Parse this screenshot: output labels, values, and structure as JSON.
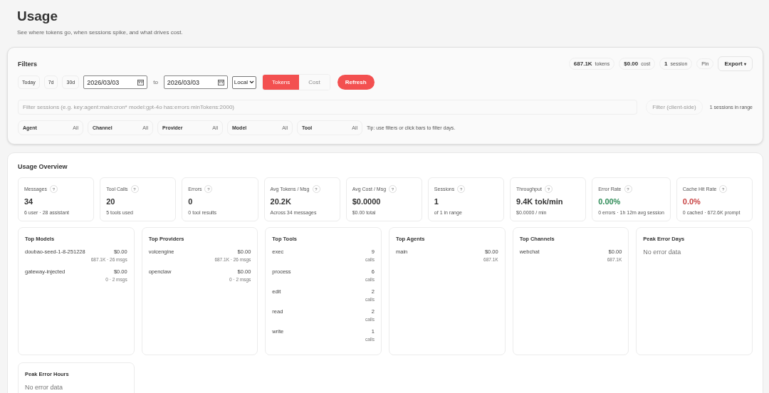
{
  "header": {
    "title": "Usage",
    "subtitle": "See where tokens go, when sessions spike, and what drives cost."
  },
  "filters": {
    "title": "Filters",
    "summary": [
      {
        "value": "687.1K",
        "unit": "tokens"
      },
      {
        "value": "$0.00",
        "unit": "cost"
      },
      {
        "value": "1",
        "unit": "session"
      }
    ],
    "actions": [
      {
        "label": "Pin",
        "kind": "pill"
      },
      {
        "label": "Export",
        "kind": "menu",
        "caret": "▾"
      }
    ],
    "presets": [
      "Today",
      "7d",
      "30d"
    ],
    "date_from": "2026/03/03",
    "separator": "to",
    "date_to": "2026/03/03",
    "timezone": "Local",
    "modes": [
      {
        "label": "Tokens",
        "selected": true
      },
      {
        "label": "Cost",
        "selected": false
      }
    ],
    "refresh": "Refresh",
    "query": {
      "placeholder": "Filter sessions (e.g. key:agent:main:cron* model:gpt-4o has:errors minTokens:2000)"
    },
    "apply": "Filter (client-side)",
    "range_note": "1 sessions in range",
    "dropdowns": [
      {
        "label": "Agent",
        "value": "All"
      },
      {
        "label": "Channel",
        "value": "All"
      },
      {
        "label": "Provider",
        "value": "All"
      },
      {
        "label": "Model",
        "value": "All"
      },
      {
        "label": "Tool",
        "value": "All"
      }
    ],
    "tip": "Tip: use filters or click bars to filter days."
  },
  "overview": {
    "title": "Usage Overview",
    "help": "?",
    "metrics": [
      {
        "label": "Messages",
        "value": "34",
        "note": "6 user · 28 assistant",
        "kind": "normal"
      },
      {
        "label": "Tool Calls",
        "value": "20",
        "note": "5 tools used",
        "kind": "normal"
      },
      {
        "label": "Errors",
        "value": "0",
        "note": "0 tool results",
        "kind": "normal"
      },
      {
        "label": "Avg Tokens / Msg",
        "value": "20.2K",
        "note": "Across 34 messages",
        "kind": "normal"
      },
      {
        "label": "Avg Cost / Msg",
        "value": "$0.0000",
        "note": "$0.00 total",
        "kind": "normal"
      },
      {
        "label": "Sessions",
        "value": "1",
        "note": "of 1 in range",
        "kind": "normal"
      },
      {
        "label": "Throughput",
        "value": "9.4K tok/min",
        "note": "$0.0000 / min",
        "kind": "normal"
      },
      {
        "label": "Error Rate",
        "value": "0.00%",
        "note": "0 errors · 1h 12m avg session",
        "kind": "good"
      },
      {
        "label": "Cache Hit Rate",
        "value": "0.0%",
        "note": "0 cached · 672.6K prompt",
        "kind": "bad"
      }
    ],
    "panels": [
      {
        "title": "Top Models",
        "kind": "list",
        "items": [
          {
            "name": "doubao-seed-1-8-251228",
            "value": "$0.00",
            "sub": "687.1K · 26 msgs"
          },
          {
            "name": "gateway-injected",
            "value": "$0.00",
            "sub": "0 · 2 msgs"
          }
        ]
      },
      {
        "title": "Top Providers",
        "kind": "list",
        "items": [
          {
            "name": "volcengine",
            "value": "$0.00",
            "sub": "687.1K · 26 msgs"
          },
          {
            "name": "openclaw",
            "value": "$0.00",
            "sub": "0 · 2 msgs"
          }
        ]
      },
      {
        "title": "Top Tools",
        "kind": "list",
        "items": [
          {
            "name": "exec",
            "value": "9",
            "sub": "calls"
          },
          {
            "name": "process",
            "value": "6",
            "sub": "calls"
          },
          {
            "name": "edit",
            "value": "2",
            "sub": "calls"
          },
          {
            "name": "read",
            "value": "2",
            "sub": "calls"
          },
          {
            "name": "write",
            "value": "1",
            "sub": "calls"
          }
        ]
      },
      {
        "title": "Top Agents",
        "kind": "list",
        "items": [
          {
            "name": "main",
            "value": "$0.00",
            "sub": "687.1K"
          }
        ]
      },
      {
        "title": "Top Channels",
        "kind": "list",
        "items": [
          {
            "name": "webchat",
            "value": "$0.00",
            "sub": "687.1K"
          }
        ]
      },
      {
        "title": "Peak Error Days",
        "kind": "empty",
        "message": "No error data"
      },
      {
        "title": "Peak Error Hours",
        "kind": "empty",
        "message": "No error data"
      }
    ]
  }
}
